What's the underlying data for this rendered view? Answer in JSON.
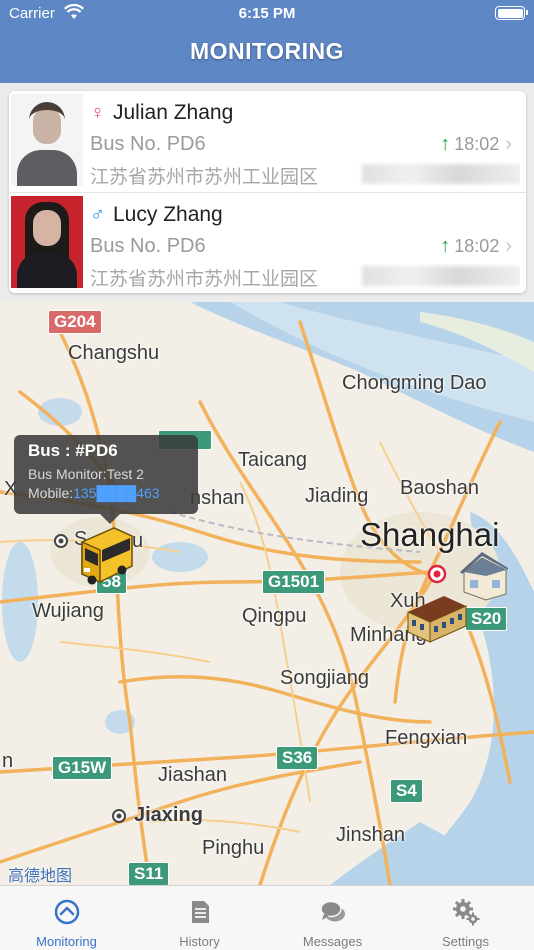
{
  "status_bar": {
    "carrier": "Carrier",
    "time": "6:15 PM"
  },
  "header": {
    "title": "MONITORING"
  },
  "students": [
    {
      "name": "Julian Zhang",
      "gender_symbol": "♀",
      "bus": "Bus No. PD6",
      "time": "18:02",
      "address": "江苏省苏州市苏州工业园区",
      "photo_bg": "#f4f4f4"
    },
    {
      "name": "Lucy Zhang",
      "gender_symbol": "♂",
      "bus": "Bus No. PD6",
      "time": "18:02",
      "address": "江苏省苏州市苏州工业园区",
      "photo_bg": "#c8242e"
    }
  ],
  "map": {
    "labels": {
      "changshu": "Changshu",
      "chongming": "Chongming Dao",
      "taicang": "Taicang",
      "jiading": "Jiading",
      "baoshan": "Baoshan",
      "shanghai": "Shanghai",
      "kunshan": "nshan",
      "suzhou": "S",
      "suzhou_tail": "u",
      "xuhui": "Xuh",
      "qingpu": "Qingpu",
      "minhang": "Minhang",
      "wujiang": "Wujiang",
      "songjiang": "Songjiang",
      "fengxian": "Fengxian",
      "jiashan": "Jiashan",
      "jiaxing": "Jiaxing",
      "pinghu": "Pinghu",
      "jinshan": "Jinshan",
      "x_edge": "X",
      "n_edge": "n"
    },
    "shields": {
      "g204": "G204",
      "g1501": "G1501",
      "s20": "S20",
      "s36": "S36",
      "s4": "S4",
      "g15w": "G15W",
      "s11": "S11",
      "s58": "58"
    },
    "attribution": "高德地图"
  },
  "bus_popup": {
    "title": "Bus : #PD6",
    "monitor": "Bus Monitor:Test 2",
    "mobile_label": "Mobile:",
    "mobile_number": "135████463"
  },
  "tabs": [
    {
      "label": "Monitoring",
      "icon": "monitoring-icon",
      "active": true
    },
    {
      "label": "History",
      "icon": "document-icon",
      "active": false
    },
    {
      "label": "Messages",
      "icon": "chat-bubbles-icon",
      "active": false
    },
    {
      "label": "Settings",
      "icon": "gears-icon",
      "active": false
    }
  ],
  "colors": {
    "header": "#5e87c5",
    "accent": "#3a72c9",
    "up_arrow": "#2a9e3e"
  }
}
